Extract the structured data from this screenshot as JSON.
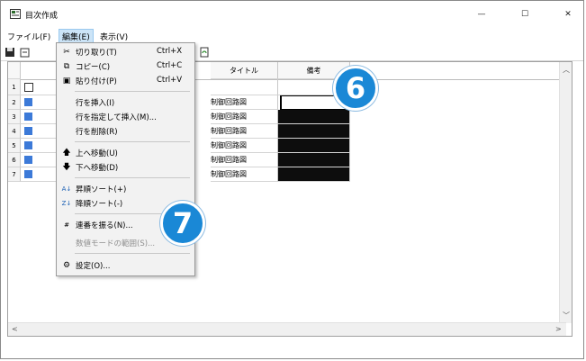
{
  "window": {
    "title": "目次作成",
    "controls": {
      "minimize": "—",
      "maximize": "☐",
      "close": "✕"
    }
  },
  "menubar": {
    "items": [
      "ファイル(F)",
      "編集(E)",
      "表示(V)"
    ]
  },
  "grid": {
    "headers": [
      "タイトル",
      "備考"
    ],
    "rows": [
      {
        "num": "1",
        "title": ""
      },
      {
        "num": "2",
        "title": "制御回路図"
      },
      {
        "num": "3",
        "title": "制御回路図"
      },
      {
        "num": "4",
        "title": "制御回路図"
      },
      {
        "num": "5",
        "title": "制御回路図"
      },
      {
        "num": "6",
        "title": "制御回路図"
      },
      {
        "num": "7",
        "title": "制御回路図"
      }
    ]
  },
  "edit_menu": {
    "items": [
      {
        "label": "切り取り(T)",
        "shortcut": "Ctrl+X",
        "icon": "scissors-icon"
      },
      {
        "label": "コピー(C)",
        "shortcut": "Ctrl+C",
        "icon": "copy-icon"
      },
      {
        "label": "貼り付け(P)",
        "shortcut": "Ctrl+V",
        "icon": "paste-icon"
      },
      {
        "label": "行を挿入(I)"
      },
      {
        "label": "行を指定して挿入(M)..."
      },
      {
        "label": "行を削除(R)"
      },
      {
        "label": "上へ移動(U)",
        "icon": "arrow-up-icon"
      },
      {
        "label": "下へ移動(D)",
        "icon": "arrow-down-icon"
      },
      {
        "label": "昇順ソート(+)",
        "icon": "sort-ascending-icon"
      },
      {
        "label": "降順ソート(-)",
        "icon": "sort-descending-icon"
      },
      {
        "label": "連番を振る(N)...",
        "icon": "numbering-icon"
      },
      {
        "label": "数値モードの範囲(S)...",
        "disabled": true
      },
      {
        "label": "設定(O)...",
        "icon": "settings-icon"
      }
    ]
  },
  "callouts": [
    "6",
    "7"
  ],
  "colors": {
    "accent": "#1a88d6",
    "menu_highlight": "#cce4f7",
    "cell_fill": "#0d0d0d"
  }
}
